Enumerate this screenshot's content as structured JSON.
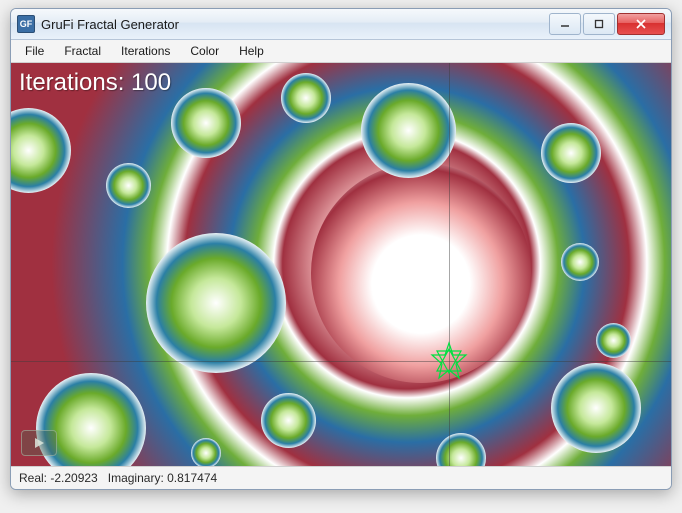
{
  "window": {
    "title": "GruFi Fractal Generator",
    "app_icon_text": "GF"
  },
  "menu": {
    "file": "File",
    "fractal": "Fractal",
    "iterations": "Iterations",
    "color": "Color",
    "help": "Help"
  },
  "overlay": {
    "iterations_label": "Iterations: 100"
  },
  "status": {
    "real_label": "Real:",
    "real_value": "-2.20923",
    "imaginary_label": "Imaginary:",
    "imaginary_value": "0.817474"
  },
  "colors": {
    "accent_green": "#6aaa2a",
    "accent_blue": "#2a7fa5",
    "accent_red": "#a03040"
  }
}
